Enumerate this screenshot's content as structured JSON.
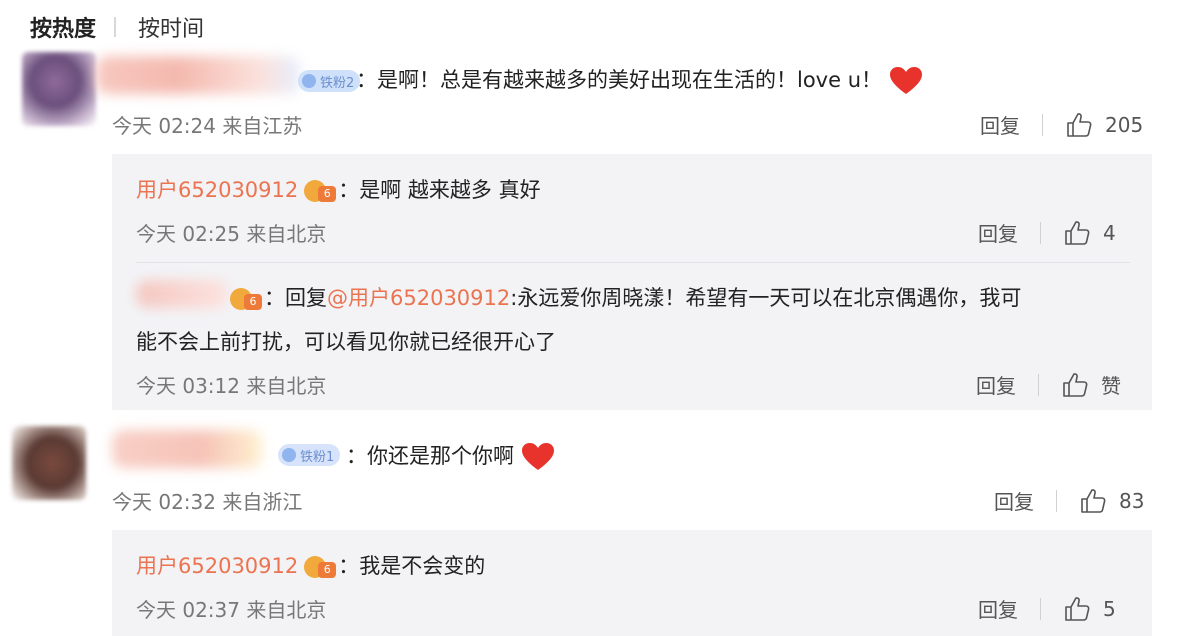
{
  "sort": {
    "hot": "按热度",
    "time": "按时间"
  },
  "comments": [
    {
      "badge": "铁粉2",
      "text": "：是啊！总是有越来越多的美好出现在生活的！love u！",
      "time": "今天 02:24 来自江苏",
      "reply_label": "回复",
      "likes": "205",
      "replies": [
        {
          "user": "用户652030912",
          "text": "：是啊 越来越多 真好",
          "time": "今天 02:25 来自北京",
          "reply_label": "回复",
          "likes": "4"
        },
        {
          "prefix": "：回复",
          "at": "@用户652030912",
          "text_line1": ":永远爱你周晓漾！希望有一天可以在北京偶遇你，我可",
          "text_line2": "能不会上前打扰，可以看见你就已经很开心了",
          "time": "今天 03:12 来自北京",
          "reply_label": "回复",
          "likes": "赞"
        }
      ]
    },
    {
      "badge": "铁粉1",
      "text": "：你还是那个你啊",
      "time": "今天 02:32 来自浙江",
      "reply_label": "回复",
      "likes": "83",
      "replies": [
        {
          "user": "用户652030912",
          "text": "：我是不会变的",
          "time": "今天 02:37 来自北京",
          "reply_label": "回复",
          "likes": "5"
        }
      ]
    }
  ],
  "vip_mark": "6",
  "colors": {
    "link": "#eb7350",
    "reply_bg": "#f3f3f6",
    "heart": "#e8322c"
  }
}
